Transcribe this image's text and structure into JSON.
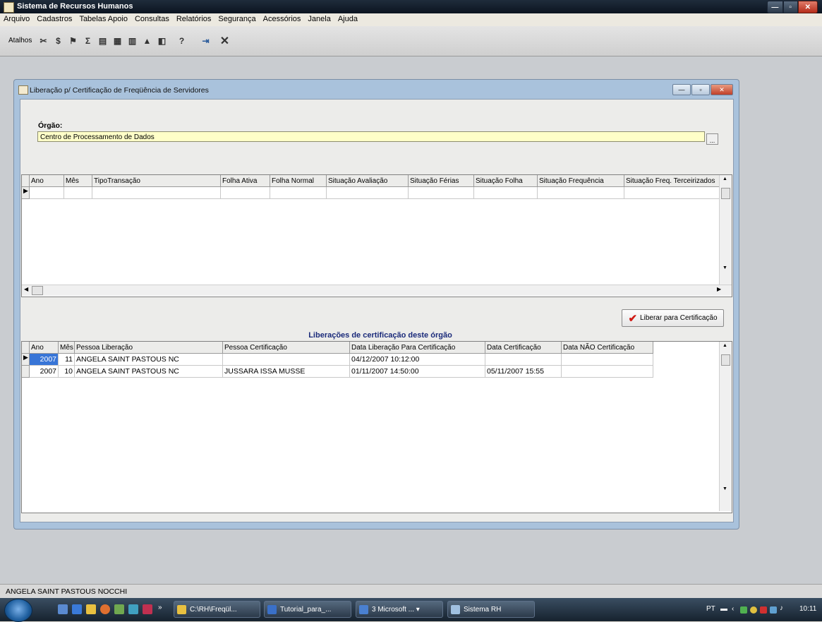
{
  "app": {
    "title": "Sistema de Recursos Humanos"
  },
  "menu": [
    "Arquivo",
    "Cadastros",
    "Tabelas Apoio",
    "Consultas",
    "Relatórios",
    "Segurança",
    "Acessórios",
    "Janela",
    "Ajuda"
  ],
  "toolbar": {
    "label": "Atalhos"
  },
  "child_window": {
    "title": "Liberação p/ Certificação de Freqüência de Servidores",
    "orgao_label": "Órgão:",
    "orgao_value": "Centro de Processamento de Dados",
    "orgao_button": "..."
  },
  "grid1": {
    "columns": [
      "Ano",
      "Mês",
      "TipoTransação",
      "Folha Ativa",
      "Folha Normal",
      "Situação Avaliação",
      "Situação Férias",
      "Situação Folha",
      "Situação Frequência",
      "Situação Freq. Terceirizados"
    ]
  },
  "liberar_button": "Liberar para Certificação",
  "grid2": {
    "title": "Liberações de certificação deste órgão",
    "columns": [
      "Ano",
      "Mês",
      "Pessoa Liberação",
      "Pessoa Certificação",
      "Data Liberação Para Certificação",
      "Data Certificação",
      "Data NÃO Certificação"
    ],
    "rows": [
      [
        "2007",
        "11",
        "ANGELA SAINT PASTOUS NC",
        "",
        "04/12/2007 10:12:00",
        "",
        ""
      ],
      [
        "2007",
        "10",
        "ANGELA SAINT PASTOUS NC",
        "JUSSARA ISSA MUSSE",
        "01/11/2007 14:50:00",
        "05/11/2007 15:55",
        ""
      ]
    ]
  },
  "status": {
    "user": "ANGELA SAINT PASTOUS NOCCHI"
  },
  "taskbar": {
    "buttons": [
      "C:\\RH\\Freqül...",
      "Tutorial_para_...",
      "3 Microsoft ...",
      "Sistema RH"
    ],
    "lang": "PT",
    "clock": "10:11"
  },
  "colors": {
    "title_bar": "#0b1420",
    "orgao_field_bg": "#ffffc8",
    "accent_check": "#d01a14",
    "grid_title": "#1a2a7a"
  }
}
